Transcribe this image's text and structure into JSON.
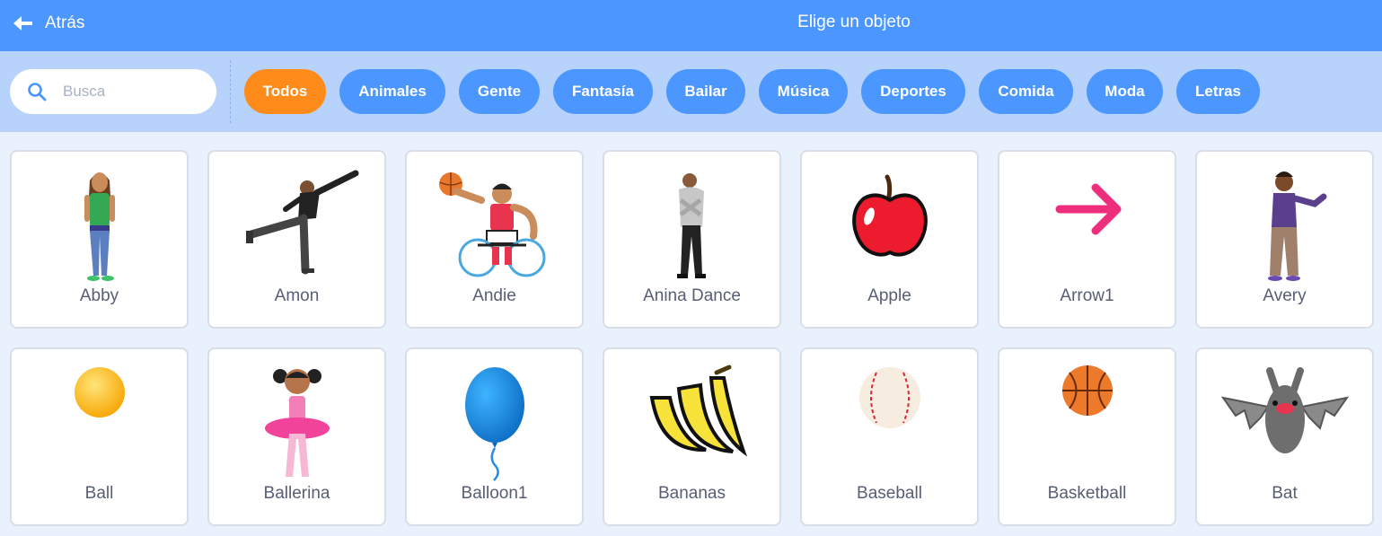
{
  "header": {
    "back_label": "Atrás",
    "title": "Elige un objeto"
  },
  "search": {
    "placeholder": "Busca",
    "value": ""
  },
  "tags": [
    "Todos",
    "Animales",
    "Gente",
    "Fantasía",
    "Bailar",
    "Música",
    "Deportes",
    "Comida",
    "Moda",
    "Letras"
  ],
  "active_tag": "Todos",
  "sprites": [
    {
      "name": "Abby",
      "icon": "abby-icon"
    },
    {
      "name": "Amon",
      "icon": "amon-icon"
    },
    {
      "name": "Andie",
      "icon": "andie-icon"
    },
    {
      "name": "Anina Dance",
      "icon": "anina-dance-icon"
    },
    {
      "name": "Apple",
      "icon": "apple-icon"
    },
    {
      "name": "Arrow1",
      "icon": "arrow1-icon"
    },
    {
      "name": "Avery",
      "icon": "avery-icon"
    },
    {
      "name": "Ball",
      "icon": "ball-icon"
    },
    {
      "name": "Ballerina",
      "icon": "ballerina-icon"
    },
    {
      "name": "Balloon1",
      "icon": "balloon1-icon"
    },
    {
      "name": "Bananas",
      "icon": "bananas-icon"
    },
    {
      "name": "Baseball",
      "icon": "baseball-icon"
    },
    {
      "name": "Basketball",
      "icon": "basketball-icon"
    },
    {
      "name": "Bat",
      "icon": "bat-icon"
    }
  ],
  "colors": {
    "header": "#4c97ff",
    "filter_bar": "#b7d2fb",
    "background": "#e9f1fc",
    "tag": "#4c97ff",
    "tag_active": "#ff8c1a",
    "card_text": "#575e75"
  }
}
